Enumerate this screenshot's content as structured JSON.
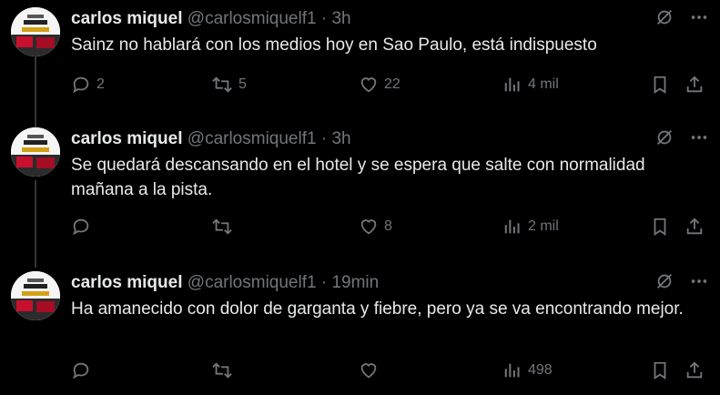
{
  "tweets": [
    {
      "name": "carlos miquel",
      "handle": "@carlosmiquelf1",
      "dot": "·",
      "time": "3h",
      "text": "Sainz no hablará con los medios hoy en Sao Paulo, está indispuesto",
      "replies": "2",
      "retweets": "5",
      "likes": "22",
      "views": "4 mil"
    },
    {
      "name": "carlos miquel",
      "handle": "@carlosmiquelf1",
      "dot": "·",
      "time": "3h",
      "text": "Se quedará descansando en el hotel y se espera que salte con normalidad mañana a la pista.",
      "replies": "",
      "retweets": "",
      "likes": "8",
      "views": "2 mil"
    },
    {
      "name": "carlos miquel",
      "handle": "@carlosmiquelf1",
      "dot": "·",
      "time": "19min",
      "text": "Ha amanecido con dolor de garganta y fiebre, pero ya se va encontrando mejor.",
      "replies": "",
      "retweets": "",
      "likes": "",
      "views": "498"
    }
  ],
  "icons": {
    "grok": "grok-icon",
    "more": "more-icon",
    "reply": "reply-icon",
    "retweet": "retweet-icon",
    "like": "like-icon",
    "views": "views-icon",
    "bookmark": "bookmark-icon",
    "share": "share-icon"
  },
  "colors": {
    "background": "#000000",
    "text": "#e7e9ea",
    "muted": "#71767b",
    "thread_line": "#333639"
  }
}
